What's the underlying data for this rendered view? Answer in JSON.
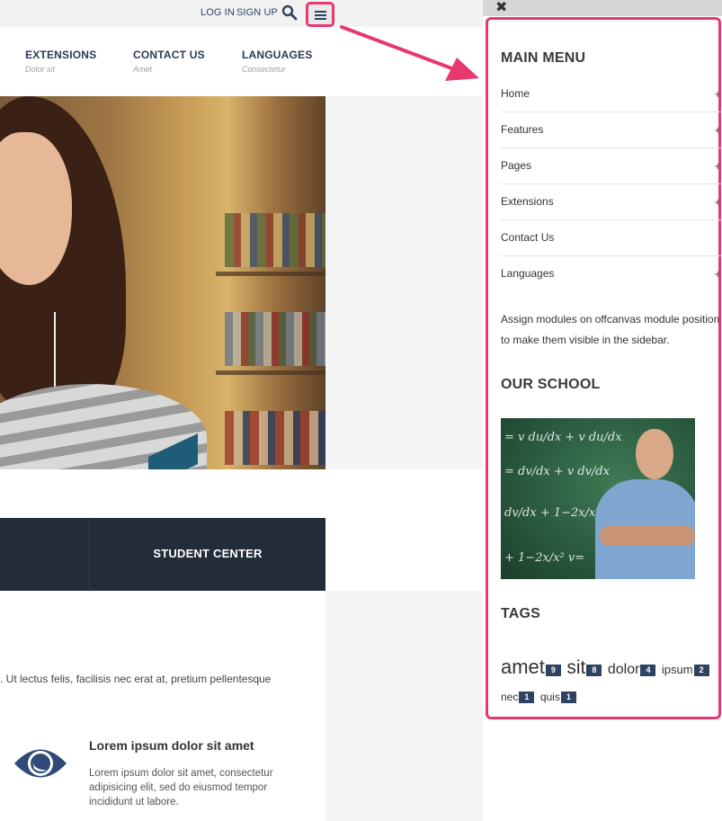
{
  "topbar": {
    "login": "LOG IN",
    "separator": "·",
    "signup": "SIGN UP"
  },
  "nav": [
    {
      "label": "EXTENSIONS",
      "sub": "Dolor sit"
    },
    {
      "label": "CONTACT US",
      "sub": "Amet"
    },
    {
      "label": "LANGUAGES",
      "sub": "Consectetur"
    }
  ],
  "band": {
    "label": "STUDENT CENTER"
  },
  "content": {
    "intro": ". Ut lectus felis, facilisis nec erat at, pretium pellentesque",
    "feature_title": "Lorem ipsum dolor sit amet",
    "feature_body": "Lorem ipsum dolor sit amet, consectetur adipisicing elit, sed do eiusmod tempor incididunt ut labore."
  },
  "offcanvas": {
    "close": "✖",
    "main_menu_title": "MAIN MENU",
    "menu": [
      {
        "label": "Home",
        "expand": "+"
      },
      {
        "label": "Features",
        "expand": "+"
      },
      {
        "label": "Pages",
        "expand": "+"
      },
      {
        "label": "Extensions",
        "expand": "+"
      },
      {
        "label": "Contact Us",
        "expand": ""
      },
      {
        "label": "Languages",
        "expand": "+"
      }
    ],
    "note": "Assign modules on offcanvas module position to make them visible in the sidebar.",
    "school_title": "OUR SCHOOL",
    "tags_title": "TAGS",
    "tags": [
      {
        "word": "amet",
        "count": "9"
      },
      {
        "word": "sit",
        "count": "8"
      },
      {
        "word": "dolor",
        "count": "4"
      },
      {
        "word": "ipsum",
        "count": "2"
      },
      {
        "word": "nec",
        "count": "1"
      },
      {
        "word": "quis",
        "count": "1"
      }
    ]
  },
  "colors": {
    "accent": "#e83870",
    "navy": "#2f4261",
    "band": "#232d3a"
  },
  "icons": {
    "search": "search-icon",
    "menu": "hamburger-menu-icon",
    "close": "close-icon",
    "feature": "eye-icon"
  }
}
